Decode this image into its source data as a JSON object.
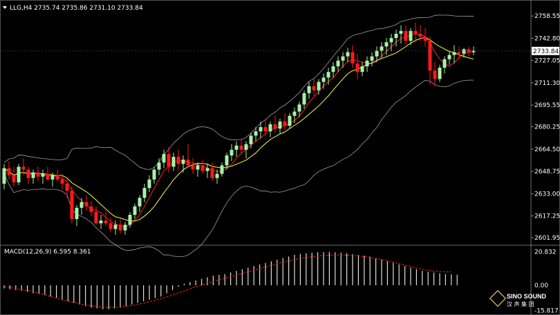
{
  "header": {
    "symbol_line": "LLG,H4  2735.74 2735.86 2731.10 2733.84",
    "macd_label": "MACD(12,26,9) 6.595 8.361",
    "logo_text": "SINO SOUND",
    "logo_sub": "汉 声 集 团"
  },
  "colors": {
    "background": "#000000",
    "bull_candle": "#a8f0a8",
    "bear_candle": "#ff1a1a",
    "ma_fast": "#ff2020",
    "ma_slow": "#ffff40",
    "bands": "#a0a0a0",
    "macd_hist": "#e0e0e0",
    "macd_signal": "#ff2020",
    "current_price_box": "#ffffff"
  },
  "chart_data": [
    {
      "type": "candlestick",
      "panel": "price",
      "ylim": [
        2598.0,
        2764.0
      ],
      "y_ticks": [
        "2758.55",
        "2742.80",
        "2727.05",
        "2711.30",
        "2695.55",
        "2680.25",
        "2664.50",
        "2648.75",
        "2633.00",
        "2617.25",
        "2601.95"
      ],
      "current_price": "2733.84",
      "candles": [
        [
          2640,
          2654,
          2636,
          2651
        ],
        [
          2651,
          2656,
          2643,
          2646
        ],
        [
          2646,
          2652,
          2638,
          2641
        ],
        [
          2641,
          2654,
          2639,
          2652
        ],
        [
          2652,
          2658,
          2646,
          2650
        ],
        [
          2650,
          2652,
          2640,
          2644
        ],
        [
          2644,
          2650,
          2640,
          2648
        ],
        [
          2648,
          2652,
          2642,
          2645
        ],
        [
          2645,
          2650,
          2640,
          2647
        ],
        [
          2647,
          2652,
          2642,
          2643
        ],
        [
          2643,
          2648,
          2638,
          2646
        ],
        [
          2646,
          2650,
          2641,
          2643
        ],
        [
          2643,
          2647,
          2636,
          2640
        ],
        [
          2640,
          2644,
          2630,
          2635
        ],
        [
          2635,
          2638,
          2612,
          2615
        ],
        [
          2615,
          2625,
          2610,
          2623
        ],
        [
          2623,
          2630,
          2618,
          2627
        ],
        [
          2627,
          2632,
          2621,
          2624
        ],
        [
          2624,
          2628,
          2617,
          2620
        ],
        [
          2620,
          2624,
          2611,
          2612
        ],
        [
          2612,
          2618,
          2608,
          2614
        ],
        [
          2614,
          2620,
          2610,
          2612
        ],
        [
          2612,
          2616,
          2606,
          2608
        ],
        [
          2608,
          2614,
          2604,
          2611
        ],
        [
          2611,
          2615,
          2605,
          2607
        ],
        [
          2607,
          2613,
          2604,
          2611
        ],
        [
          2611,
          2620,
          2609,
          2618
        ],
        [
          2618,
          2626,
          2615,
          2624
        ],
        [
          2624,
          2632,
          2620,
          2630
        ],
        [
          2630,
          2640,
          2627,
          2637
        ],
        [
          2637,
          2646,
          2634,
          2643
        ],
        [
          2643,
          2652,
          2640,
          2650
        ],
        [
          2650,
          2658,
          2646,
          2655
        ],
        [
          2655,
          2664,
          2651,
          2661
        ],
        [
          2661,
          2666,
          2648,
          2652
        ],
        [
          2652,
          2662,
          2649,
          2659
        ],
        [
          2659,
          2664,
          2650,
          2654
        ],
        [
          2654,
          2660,
          2648,
          2657
        ],
        [
          2657,
          2668,
          2651,
          2653
        ],
        [
          2653,
          2658,
          2647,
          2650
        ],
        [
          2650,
          2655,
          2645,
          2653
        ],
        [
          2653,
          2657,
          2647,
          2649
        ],
        [
          2649,
          2654,
          2644,
          2651
        ],
        [
          2651,
          2655,
          2642,
          2644
        ],
        [
          2644,
          2650,
          2640,
          2647
        ],
        [
          2647,
          2655,
          2645,
          2653
        ],
        [
          2653,
          2662,
          2650,
          2660
        ],
        [
          2660,
          2668,
          2656,
          2664
        ],
        [
          2664,
          2670,
          2659,
          2667
        ],
        [
          2667,
          2672,
          2661,
          2664
        ],
        [
          2664,
          2670,
          2658,
          2668
        ],
        [
          2668,
          2676,
          2665,
          2674
        ],
        [
          2674,
          2680,
          2670,
          2677
        ],
        [
          2677,
          2684,
          2672,
          2680
        ],
        [
          2680,
          2686,
          2674,
          2677
        ],
        [
          2677,
          2684,
          2673,
          2682
        ],
        [
          2682,
          2688,
          2676,
          2679
        ],
        [
          2679,
          2686,
          2675,
          2684
        ],
        [
          2684,
          2690,
          2678,
          2681
        ],
        [
          2681,
          2690,
          2679,
          2688
        ],
        [
          2688,
          2694,
          2683,
          2691
        ],
        [
          2691,
          2698,
          2687,
          2696
        ],
        [
          2696,
          2706,
          2693,
          2704
        ],
        [
          2704,
          2712,
          2700,
          2709
        ],
        [
          2709,
          2714,
          2702,
          2706
        ],
        [
          2706,
          2714,
          2703,
          2712
        ],
        [
          2712,
          2718,
          2707,
          2715
        ],
        [
          2715,
          2722,
          2710,
          2719
        ],
        [
          2719,
          2726,
          2715,
          2723
        ],
        [
          2723,
          2730,
          2719,
          2727
        ],
        [
          2727,
          2733,
          2722,
          2730
        ],
        [
          2730,
          2736,
          2726,
          2733
        ],
        [
          2733,
          2738,
          2722,
          2725
        ],
        [
          2725,
          2732,
          2714,
          2719
        ],
        [
          2719,
          2726,
          2716,
          2723
        ],
        [
          2723,
          2730,
          2719,
          2727
        ],
        [
          2727,
          2733,
          2723,
          2730
        ],
        [
          2730,
          2737,
          2726,
          2734
        ],
        [
          2734,
          2740,
          2729,
          2737
        ],
        [
          2737,
          2743,
          2731,
          2740
        ],
        [
          2740,
          2746,
          2734,
          2743
        ],
        [
          2743,
          2749,
          2737,
          2746
        ],
        [
          2746,
          2752,
          2739,
          2748
        ],
        [
          2748,
          2752,
          2738,
          2741
        ],
        [
          2741,
          2750,
          2738,
          2748
        ],
        [
          2748,
          2754,
          2740,
          2746
        ],
        [
          2746,
          2752,
          2741,
          2744
        ],
        [
          2744,
          2750,
          2737,
          2741
        ],
        [
          2741,
          2744,
          2710,
          2720
        ],
        [
          2720,
          2726,
          2709,
          2714
        ],
        [
          2714,
          2724,
          2712,
          2722
        ],
        [
          2722,
          2730,
          2718,
          2728
        ],
        [
          2728,
          2734,
          2724,
          2731
        ],
        [
          2731,
          2738,
          2725,
          2733
        ],
        [
          2733,
          2737,
          2728,
          2732
        ],
        [
          2732,
          2736,
          2729,
          2735
        ],
        [
          2735,
          2737,
          2730,
          2733
        ],
        [
          2733,
          2737,
          2731,
          2734
        ]
      ]
    },
    {
      "type": "bar",
      "panel": "macd",
      "ylim": [
        -16.0,
        22.0
      ],
      "y_ticks": [
        "20.832",
        "0.00",
        "-15.817"
      ],
      "histogram": [
        -2,
        -2.5,
        -3,
        -3.5,
        -4,
        -5,
        -5.5,
        -6,
        -7,
        -8,
        -9,
        -10,
        -11,
        -12,
        -13,
        -14,
        -14.5,
        -15,
        -15,
        -14.5,
        -14,
        -13,
        -12,
        -11,
        -10,
        -9,
        -8,
        -7,
        -5,
        -3,
        -1,
        1,
        2,
        3,
        4,
        5,
        6,
        6.5,
        7,
        8,
        9,
        10,
        11,
        12,
        13,
        14,
        15,
        16,
        17,
        18,
        19,
        19.5,
        20,
        20.3,
        20.6,
        20.8,
        20.8,
        20.6,
        20.3,
        20,
        19.5,
        19,
        18.5,
        18,
        17,
        16,
        15,
        14,
        13,
        12,
        11,
        10,
        9,
        8.5,
        8,
        7.5,
        7,
        6.8,
        6.6
      ],
      "signal": [
        -1,
        -1.4,
        -2,
        -2.6,
        -3.3,
        -4,
        -5,
        -6,
        -7,
        -8,
        -9,
        -10,
        -10.8,
        -11.5,
        -12.2,
        -12.8,
        -13.3,
        -13.6,
        -13.8,
        -13.8,
        -13.6,
        -13.2,
        -12.7,
        -12,
        -11.2,
        -10.3,
        -9.4,
        -8.4,
        -7.3,
        -6.1,
        -4.8,
        -3.5,
        -2.2,
        -1,
        0.2,
        1.3,
        2.4,
        3.4,
        4.4,
        5.4,
        6.4,
        7.4,
        8.4,
        9.4,
        10.4,
        11.4,
        12.4,
        13.4,
        14.4,
        15.3,
        16.1,
        16.8,
        17.4,
        17.9,
        18.3,
        18.6,
        18.8,
        18.9,
        18.9,
        18.8,
        18.6,
        18.3,
        17.9,
        17.4,
        16.8,
        16.1,
        15.3,
        14.4,
        13.5,
        12.6,
        11.7,
        10.8,
        10,
        9.4,
        8.9,
        8.6,
        8.4,
        8.36
      ]
    }
  ]
}
